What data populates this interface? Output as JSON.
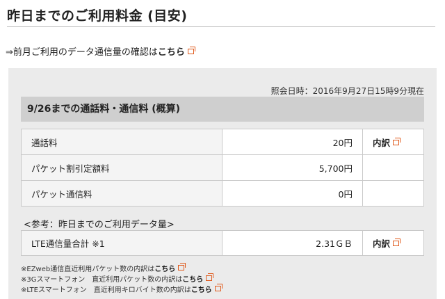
{
  "page": {
    "title": "昨日までのご利用料金 (目安)"
  },
  "prev_month": {
    "text": "⇒前月ご利用のデータ通信量の確認は",
    "link": "こちら"
  },
  "panel": {
    "datetime": "照会日時：2016年9月27日15時9分現在",
    "section_title": "9/26までの通話料・通信料 (概算)",
    "fees": [
      {
        "label": "通話料",
        "amount": "20円",
        "detail": "内訳"
      },
      {
        "label": "パケット割引定額料",
        "amount": "5,700円",
        "detail": ""
      },
      {
        "label": "パケット通信料",
        "amount": "0円",
        "detail": ""
      }
    ],
    "reference_note": "<参考：昨日までのご利用データ量>",
    "data_usage": {
      "label": "LTE通信量合計 ※1",
      "amount": "2.31ＧＢ",
      "detail": "内訳"
    },
    "footnotes": [
      {
        "text": "※EZweb通信直近利用パケット数の内訳は",
        "link": "こちら"
      },
      {
        "text": "※3Gスマートフォン　直近利用パケット数の内訳は",
        "link": "こちら"
      },
      {
        "text": "※LTEスマートフォン　直近利用キロバイト数の内訳は",
        "link": "こちら"
      }
    ]
  },
  "colors": {
    "accent": "#e05a1c",
    "panel_bg": "#ebebeb",
    "header_bg": "#cfcfcf",
    "label_bg": "#f4f4f4"
  },
  "icons": {
    "external_link": "external-link-icon"
  }
}
